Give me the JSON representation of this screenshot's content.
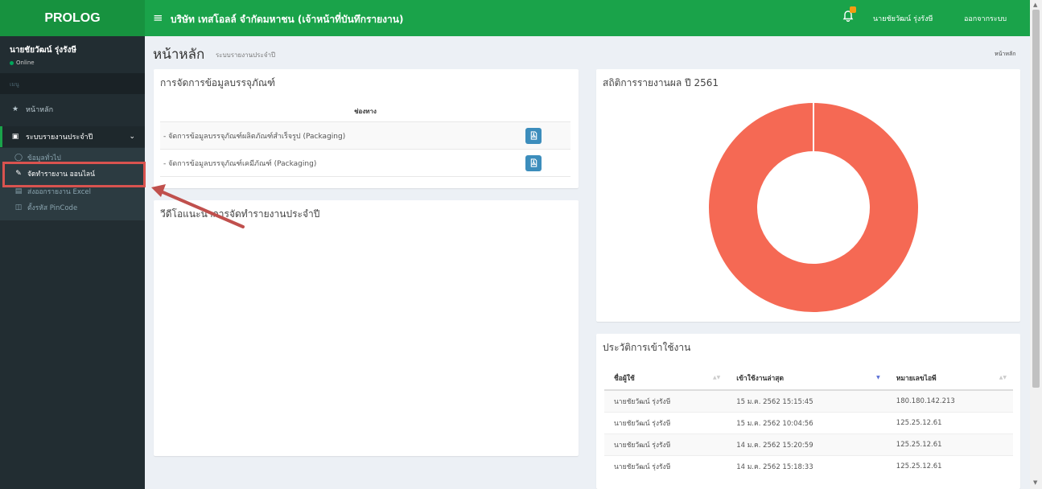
{
  "header": {
    "logo": "PROLOG",
    "menu_icon": "≡",
    "company": "บริษัท เทสโอลล์ จำกัดมหาชน (เจ้าหน้าที่บันทึกรายงาน)",
    "user": "นายชัยวัฒน์ รุ่งรังษี",
    "logout": "ออกจากระบบ"
  },
  "sidebar": {
    "user_name": "นายชัยวัฒน์ รุ่งรังษี",
    "status": "Online",
    "menu_header": "เมนู",
    "home": "หน้าหลัก",
    "report_menu": "ระบบรายงานประจำปี",
    "sub_items": [
      {
        "label": "ข้อมูลทั่วไป",
        "icon": "circle-icon"
      },
      {
        "label": "จัดทำรายงาน ออนไลน์",
        "icon": "edit-icon"
      },
      {
        "label": "ส่งออกรายงาน Excel",
        "icon": "excel-icon"
      },
      {
        "label": "ตั้งรหัส PinCode",
        "icon": "lock-icon"
      }
    ]
  },
  "page": {
    "title": "หน้าหลัก",
    "subtitle": "ระบบรายงานประจำปี",
    "breadcrumb": "หน้าหลัก"
  },
  "packaging": {
    "title": "การจัดการข้อมูลบรรจุภัณฑ์",
    "column": "ช่องทาง",
    "rows": [
      "- จัดการข้อมูลบรรจุภัณฑ์ผลิตภัณฑ์สำเร็จรูป (Packaging)",
      "- จัดการข้อมูลบรรจุภัณฑ์เคมีภัณฑ์ (Packaging)"
    ]
  },
  "video": {
    "title": "วีดีโอแนะนำการจัดทำรายงานประจำปี"
  },
  "stats": {
    "title": "สถิติการรายงานผล ปี 2561"
  },
  "chart_data": {
    "type": "pie",
    "title": "สถิติการรายงานผล ปี 2561",
    "values": [
      100
    ],
    "colors": [
      "#f56954"
    ]
  },
  "history": {
    "title": "ประวัติการเข้าใช้งาน",
    "columns": [
      "ชื่อผู้ใช้",
      "เข้าใช้งานล่าสุด",
      "หมายเลขไอพี"
    ],
    "rows": [
      [
        "นายชัยวัฒน์ รุ่งรังษี",
        "15 ม.ค. 2562 15:15:45",
        "180.180.142.213"
      ],
      [
        "นายชัยวัฒน์ รุ่งรังษี",
        "15 ม.ค. 2562 10:04:56",
        "125.25.12.61"
      ],
      [
        "นายชัยวัฒน์ รุ่งรังษี",
        "14 ม.ค. 2562 15:20:59",
        "125.25.12.61"
      ],
      [
        "นายชัยวัฒน์ รุ่งรังษี",
        "14 ม.ค. 2562 15:18:33",
        "125.25.12.61"
      ]
    ]
  },
  "colors": {
    "brand_green": "#1aa34a",
    "sidebar": "#222d32",
    "chart": "#f56954",
    "button": "#3c8dbc"
  }
}
